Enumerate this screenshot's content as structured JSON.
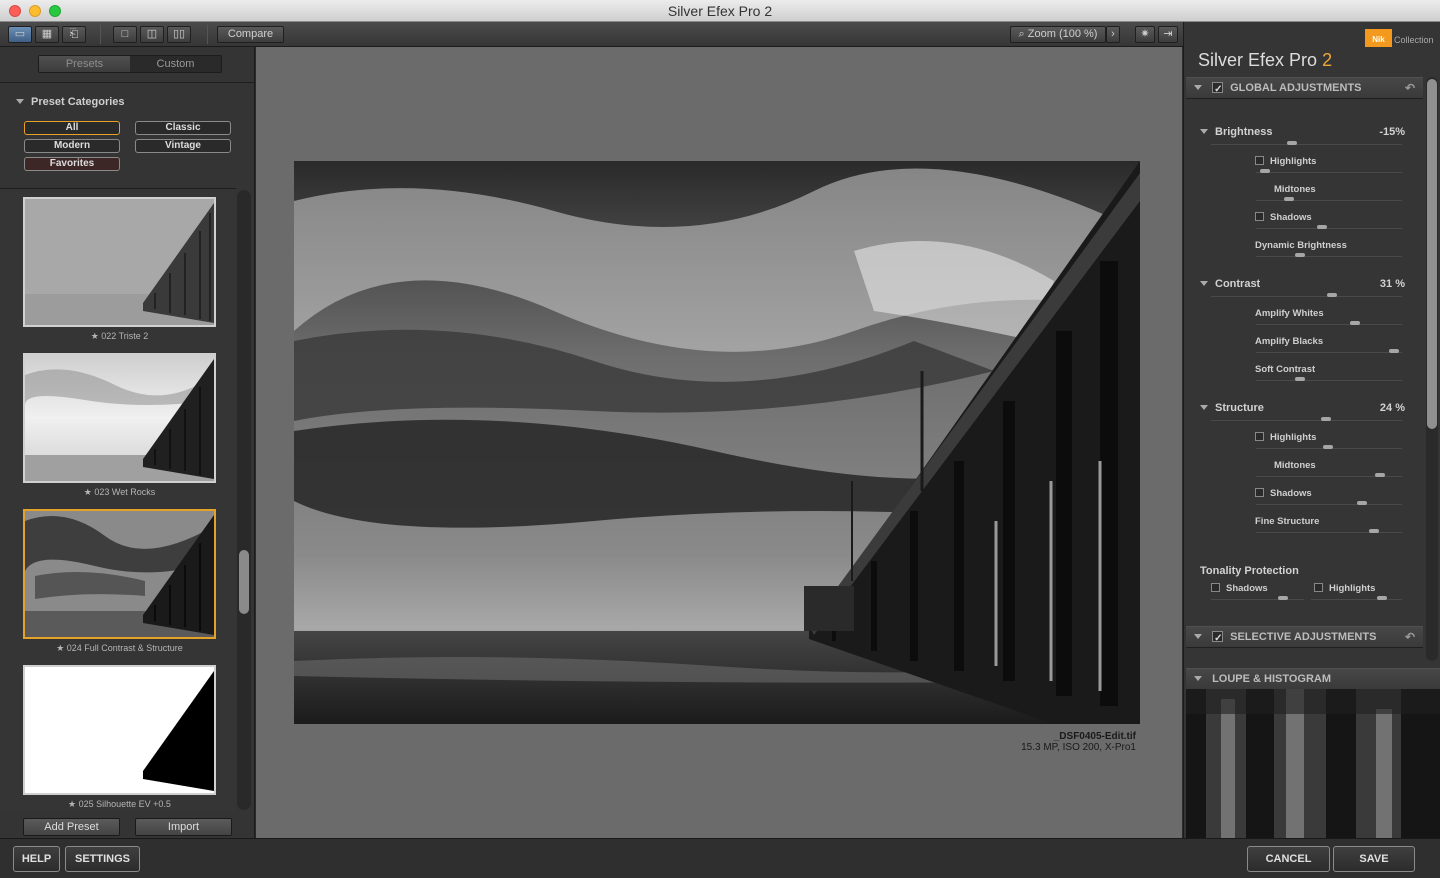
{
  "window": {
    "title": "Silver Efex Pro 2"
  },
  "toolbar": {
    "compare_label": "Compare",
    "zoom_label": "Zoom (100 %)"
  },
  "left": {
    "tabs": [
      "Presets",
      "Custom"
    ],
    "preset_categories_label": "Preset Categories",
    "categories": [
      "All",
      "Classic",
      "Modern",
      "Vintage",
      "Favorites"
    ],
    "presets": [
      {
        "label": "★ 022 Triste 2"
      },
      {
        "label": "★ 023 Wet Rocks"
      },
      {
        "label": "★ 024 Full Contrast & Structure"
      },
      {
        "label": "★ 025 Silhouette EV +0.5"
      }
    ],
    "add_preset_label": "Add Preset",
    "import_label": "Import"
  },
  "image": {
    "filename": "_DSF0405-Edit.tif",
    "meta": "15.3 MP, ISO 200, X-Pro1"
  },
  "right": {
    "logo_text": "Nik",
    "collection_label": "Collection",
    "app_title": "Silver Efex Pro",
    "app_version": "2",
    "global_label": "GLOBAL ADJUSTMENTS",
    "brightness": {
      "label": "Brightness",
      "value": "-15%",
      "highlights": "Highlights",
      "midtones": "Midtones",
      "shadows": "Shadows",
      "dynamic": "Dynamic Brightness"
    },
    "contrast": {
      "label": "Contrast",
      "value": "31 %",
      "amplify_whites": "Amplify Whites",
      "amplify_blacks": "Amplify Blacks",
      "soft": "Soft Contrast"
    },
    "structure": {
      "label": "Structure",
      "value": "24 %",
      "highlights": "Highlights",
      "midtones": "Midtones",
      "shadows": "Shadows",
      "fine": "Fine Structure"
    },
    "tonality": {
      "label": "Tonality Protection",
      "shadows": "Shadows",
      "highlights": "Highlights"
    },
    "selective_label": "SELECTIVE ADJUSTMENTS",
    "loupe_label": "LOUPE & HISTOGRAM"
  },
  "bottom": {
    "help": "HELP",
    "settings": "SETTINGS",
    "cancel": "CANCEL",
    "save": "SAVE"
  },
  "colors": {
    "accent": "#e5a128",
    "nik_orange": "#f39a1e",
    "version_orange": "#f0a73a"
  }
}
